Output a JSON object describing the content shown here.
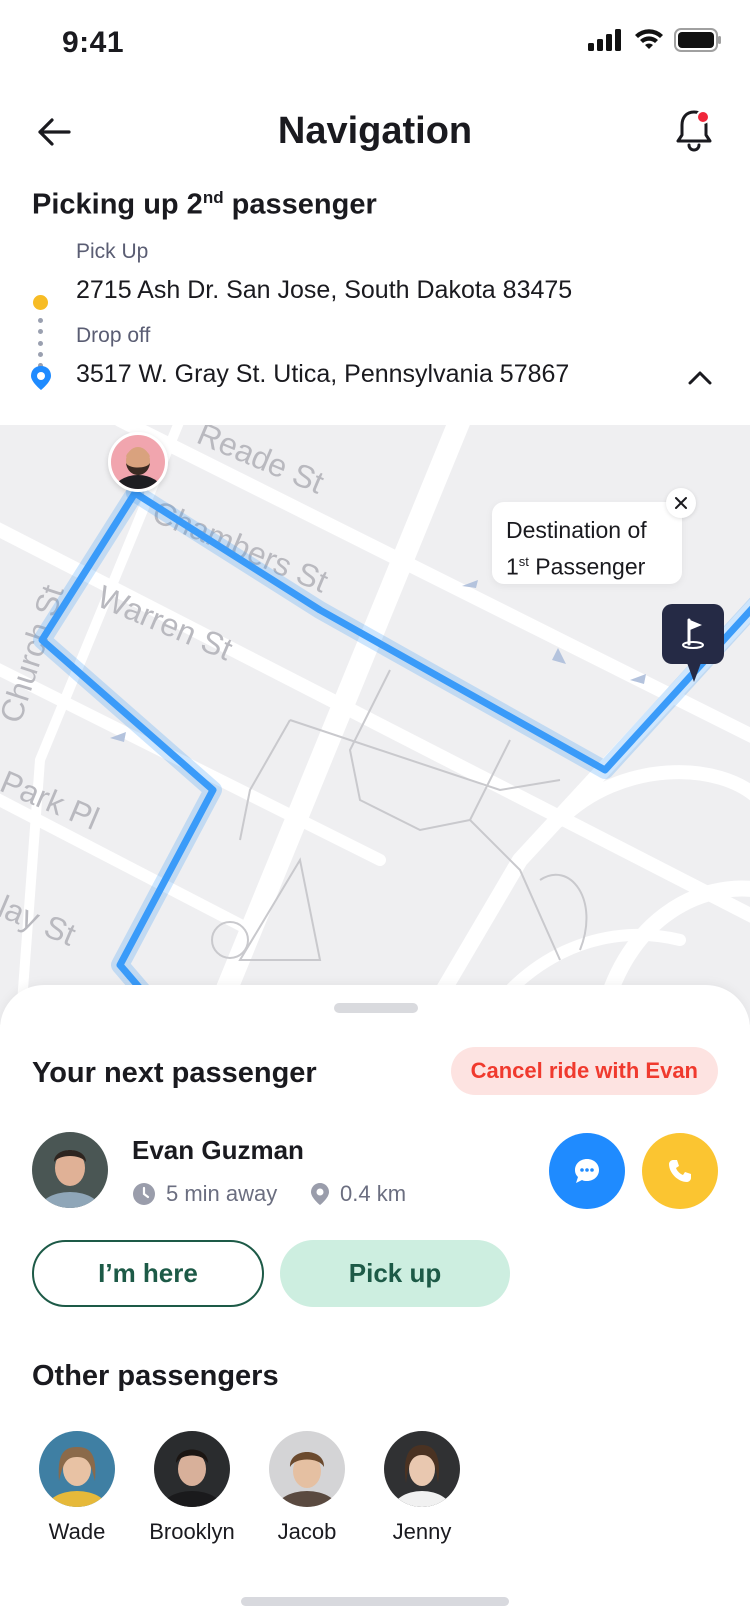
{
  "status_bar": {
    "time": "9:41"
  },
  "header": {
    "title": "Navigation"
  },
  "trip": {
    "heading_pre": "Picking up 2",
    "heading_sup": "nd",
    "heading_post": " passenger",
    "pickup_label": "Pick Up",
    "pickup_address": "2715 Ash Dr. San Jose, South Dakota 83475",
    "dropoff_label": "Drop off",
    "dropoff_address": "3517 W. Gray St. Utica, Pennsylvania 57867"
  },
  "map": {
    "streets": [
      "Reade St",
      "Chambers St",
      "Warren St",
      "Church St",
      "Park Pl",
      "lay St"
    ],
    "tooltip_line1": "Destination of",
    "tooltip_line2_pre": "1",
    "tooltip_line2_sup": "st",
    "tooltip_line2_post": " Passenger",
    "route_color": "#3a9bf9"
  },
  "next_passenger": {
    "section_title": "Your next passenger",
    "cancel_label": "Cancel ride with Evan",
    "name": "Evan Guzman",
    "eta": "5 min away",
    "distance": "0.4 km",
    "im_here_label": "I’m here",
    "pickup_label": "Pick up"
  },
  "other_passengers": {
    "section_title": "Other passengers",
    "items": [
      {
        "name": "Wade"
      },
      {
        "name": "Brooklyn"
      },
      {
        "name": "Jacob"
      },
      {
        "name": "Jenny"
      }
    ]
  },
  "colors": {
    "accent_blue": "#1f8bff",
    "accent_yellow": "#fbc531",
    "cancel_red": "#f03a2e",
    "primary_green": "#1d5a47"
  }
}
